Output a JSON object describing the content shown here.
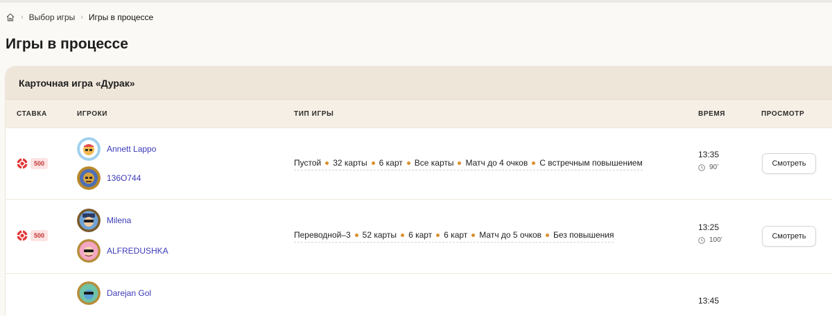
{
  "breadcrumb": {
    "home_icon": "home-icon",
    "items": [
      "Выбор игры",
      "Игры в процессе"
    ]
  },
  "page": {
    "title": "Игры в процессе"
  },
  "card": {
    "title": "Карточная игра «Дурак»",
    "columns": {
      "stake": "СТАВКА",
      "players": "ИГРОКИ",
      "game_type": "ТИП ИГРЫ",
      "time": "ВРЕМЯ",
      "view": "ПРОСМОТР"
    },
    "games": [
      {
        "stake": "500",
        "players": [
          "Annett Lappo",
          "136O744"
        ],
        "type": [
          "Пустой",
          "32 карты",
          "6 карт",
          "Все карты",
          "Матч до 4 очков",
          "С встречным повышением"
        ],
        "time": "13:35",
        "duration": "90’",
        "button": "Смотреть"
      },
      {
        "stake": "500",
        "players": [
          "Milena",
          "ALFREDUSHKA"
        ],
        "type": [
          "Переводной–3",
          "52 карты",
          "6 карт",
          "6 карт",
          "Матч до 5 очков",
          "Без повышения"
        ],
        "time": "13:25",
        "duration": "100’",
        "button": "Смотреть"
      },
      {
        "stake": "",
        "players": [
          "Darejan Gol"
        ],
        "type": [],
        "time": "13:45",
        "duration": "",
        "button": ""
      }
    ]
  },
  "colors": {
    "accent_link": "#3b3ab8",
    "card_header_bg": "#efe6da",
    "stake_badge_bg": "#fde3e3",
    "stake_badge_text": "#c23434",
    "dot": "#d9902a"
  }
}
